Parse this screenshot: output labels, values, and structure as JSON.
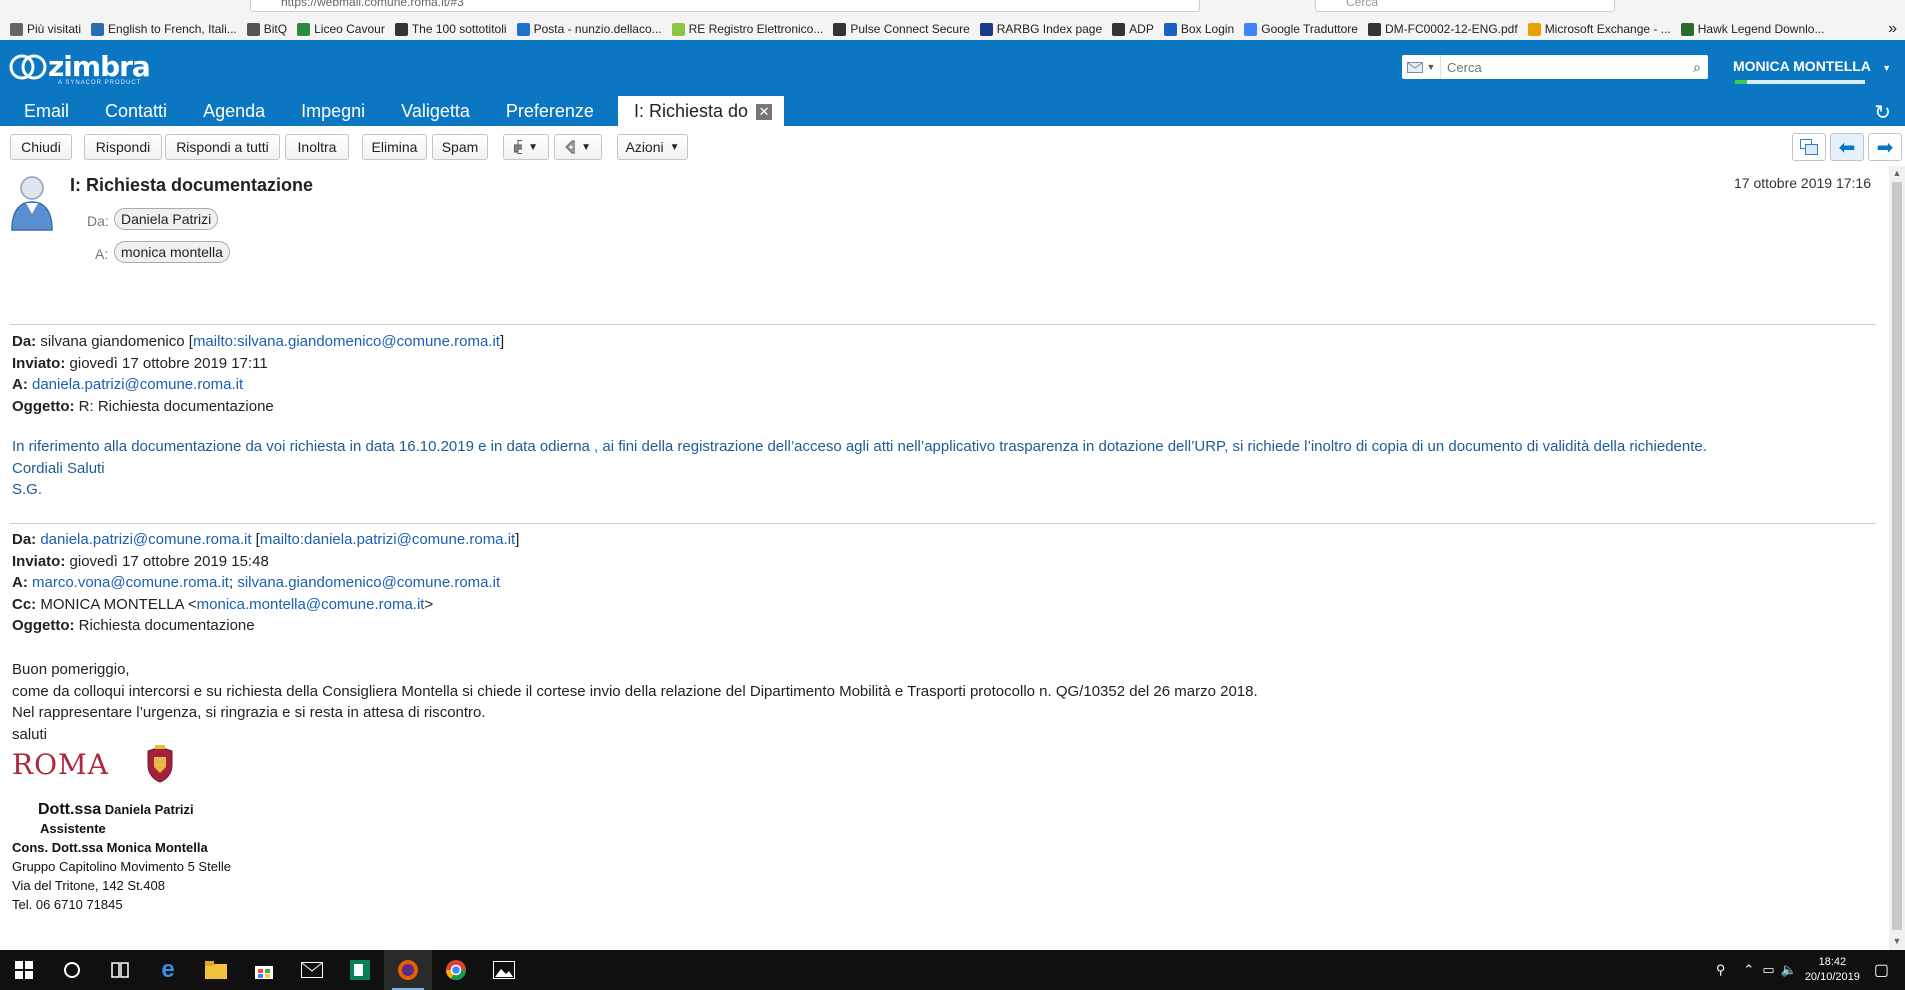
{
  "browser": {
    "url": "https://webmail.comune.roma.it/#3",
    "search_placeholder": "Cerca",
    "bookmarks": [
      {
        "label": "Più visitati",
        "icon": "gear-icon",
        "color": "#666666"
      },
      {
        "label": "English to French, Itali...",
        "icon": "wr-icon",
        "color": "#2b6cb0"
      },
      {
        "label": "BitQ",
        "icon": "bitq-icon",
        "color": "#555555"
      },
      {
        "label": "Liceo Cavour",
        "icon": "school-icon",
        "color": "#2d8a3e"
      },
      {
        "label": "The 100 sottotitoli",
        "icon": "subtitles-icon",
        "color": "#333333"
      },
      {
        "label": "Posta - nunzio.dellaco...",
        "icon": "outlook-icon",
        "color": "#1e6fd0"
      },
      {
        "label": "RE Registro Elettronico...",
        "icon": "re-icon",
        "color": "#8cc63f"
      },
      {
        "label": "Pulse Connect Secure",
        "icon": "globe-icon",
        "color": "#333333"
      },
      {
        "label": "RARBG Index page",
        "icon": "r-icon",
        "color": "#1a3a8a"
      },
      {
        "label": "ADP",
        "icon": "globe-icon",
        "color": "#333333"
      },
      {
        "label": "Box Login",
        "icon": "box-icon",
        "color": "#1a60c0"
      },
      {
        "label": "Google Traduttore",
        "icon": "translate-icon",
        "color": "#4285f4"
      },
      {
        "label": "DM-FC0002-12-ENG.pdf",
        "icon": "globe-icon",
        "color": "#333333"
      },
      {
        "label": "Microsoft Exchange - ...",
        "icon": "exchange-icon",
        "color": "#e8a000"
      },
      {
        "label": "Hawk Legend Downlo...",
        "icon": "hawk-icon",
        "color": "#2d6a2d"
      }
    ]
  },
  "app": {
    "logo": "zimbra",
    "logo_sub": "A SYNACOR PRODUCT",
    "search_placeholder": "Cerca",
    "user": "MONICA MONTELLA",
    "tabs": [
      {
        "label": "Email"
      },
      {
        "label": "Contatti"
      },
      {
        "label": "Agenda"
      },
      {
        "label": "Impegni"
      },
      {
        "label": "Valigetta"
      },
      {
        "label": "Preferenze"
      }
    ],
    "active_tab": "I: Richiesta do",
    "accent": "#0b76c2"
  },
  "toolbar": {
    "close": "Chiudi",
    "reply": "Rispondi",
    "reply_all": "Rispondi a tutti",
    "forward": "Inoltra",
    "delete": "Elimina",
    "spam": "Spam",
    "actions": "Azioni"
  },
  "message": {
    "subject": "I: Richiesta documentazione",
    "date": "17 ottobre 2019 17:16",
    "from_label": "Da:",
    "from": "Daniela Patrizi",
    "to_label": "A:",
    "to": "monica montella"
  },
  "quoted1": {
    "from_label": "Da:",
    "from_name": "silvana giandomenico [",
    "from_link": "mailto:silvana.giandomenico@comune.roma.it",
    "from_close": "]",
    "sent_label": "Inviato:",
    "sent": "giovedì 17 ottobre 2019 17:11",
    "to_label": "A:",
    "to": "daniela.patrizi@comune.roma.it",
    "subject_label": "Oggetto:",
    "subject": "R: Richiesta documentazione",
    "body": "In riferimento alla documentazione da voi richiesta in data 16.10.2019 e in data odierna , ai fini della registrazione dell’acceso agli atti nell’applicativo trasparenza in dotazione dell’URP, si richiede l’inoltro di copia di un documento di validità della richiedente.",
    "closing": "Cordiali Saluti",
    "initials": "S.G."
  },
  "quoted2": {
    "from_label": "Da:",
    "from_link": "daniela.patrizi@comune.roma.it",
    "from_mid": " [",
    "from_mailto": "mailto:daniela.patrizi@comune.roma.it",
    "from_close": "]",
    "sent_label": "Inviato:",
    "sent": "giovedì 17 ottobre 2019 15:48",
    "to_label": "A:",
    "to1": "marco.vona@comune.roma.it",
    "to_sep": "; ",
    "to2": "silvana.giandomenico@comune.roma.it",
    "cc_label": "Cc:",
    "cc_name": "MONICA MONTELLA <",
    "cc_link": "monica.montella@comune.roma.it",
    "cc_close": ">",
    "subject_label": "Oggetto:",
    "subject": "Richiesta documentazione",
    "greeting": "Buon pomeriggio,",
    "line1": "come da colloqui intercorsi e su richiesta della Consigliera Montella  si chiede il cortese invio della relazione del Dipartimento Mobilità e Trasporti protocollo n. QG/10352 del 26 marzo 2018.",
    "line2": "Nel rappresentare l’urgenza, si ringrazia e si resta in attesa di riscontro.",
    "line3": "saluti"
  },
  "signature": {
    "logo_text": "ROMA",
    "title_big": "Dott.ssa",
    "name": " Daniela Patrizi",
    "role": "Assistente",
    "line1": "Cons. Dott.ssa Monica Montella",
    "line2": "Gruppo Capitolino Movimento 5 Stelle",
    "line3": "Via del Tritone, 142 St.408",
    "line4": "Tel. 06 6710 71845"
  },
  "taskbar": {
    "time": "18:42",
    "date": "20/10/2019"
  }
}
